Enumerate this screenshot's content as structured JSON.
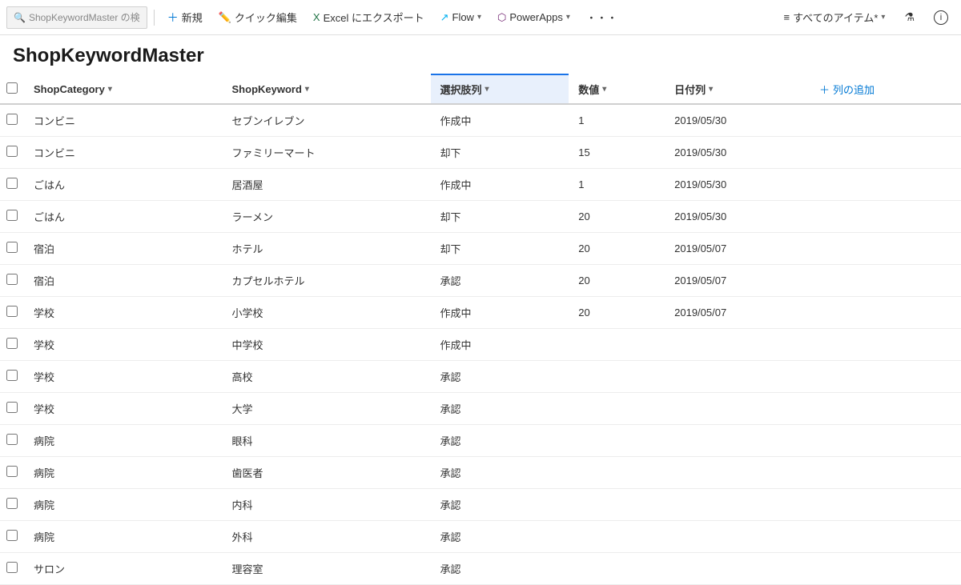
{
  "toolbar": {
    "search_placeholder": "ShopKeywordMaster の検",
    "new_label": "新規",
    "quick_edit_label": "クイック編集",
    "export_excel_label": "Excel にエクスポート",
    "flow_label": "Flow",
    "powerapps_label": "PowerApps",
    "more_label": "・・・",
    "all_items_label": "すべてのアイテム*",
    "filter_label": "",
    "info_label": ""
  },
  "page": {
    "title": "ShopKeywordMaster"
  },
  "table": {
    "columns": [
      {
        "key": "shopCategory",
        "label": "ShopCategory",
        "has_chevron": true,
        "selected": false
      },
      {
        "key": "shopKeyword",
        "label": "ShopKeyword",
        "has_chevron": true,
        "selected": false
      },
      {
        "key": "selectCol",
        "label": "選択肢列",
        "has_chevron": true,
        "selected": true
      },
      {
        "key": "value",
        "label": "数値",
        "has_chevron": true,
        "selected": false
      },
      {
        "key": "dateCol",
        "label": "日付列",
        "has_chevron": true,
        "selected": false
      },
      {
        "key": "addCol",
        "label": "+ 列の追加",
        "has_chevron": false,
        "selected": false
      }
    ],
    "rows": [
      {
        "shopCategory": "コンビニ",
        "shopKeyword": "セブンイレブン",
        "selectCol": "作成中",
        "value": "1",
        "dateCol": "2019/05/30"
      },
      {
        "shopCategory": "コンビニ",
        "shopKeyword": "ファミリーマート",
        "selectCol": "却下",
        "value": "15",
        "dateCol": "2019/05/30"
      },
      {
        "shopCategory": "ごはん",
        "shopKeyword": "居酒屋",
        "selectCol": "作成中",
        "value": "1",
        "dateCol": "2019/05/30"
      },
      {
        "shopCategory": "ごはん",
        "shopKeyword": "ラーメン",
        "selectCol": "却下",
        "value": "20",
        "dateCol": "2019/05/30"
      },
      {
        "shopCategory": "宿泊",
        "shopKeyword": "ホテル",
        "selectCol": "却下",
        "value": "20",
        "dateCol": "2019/05/07"
      },
      {
        "shopCategory": "宿泊",
        "shopKeyword": "カプセルホテル",
        "selectCol": "承認",
        "value": "20",
        "dateCol": "2019/05/07"
      },
      {
        "shopCategory": "学校",
        "shopKeyword": "小学校",
        "selectCol": "作成中",
        "value": "20",
        "dateCol": "2019/05/07"
      },
      {
        "shopCategory": "学校",
        "shopKeyword": "中学校",
        "selectCol": "作成中",
        "value": "",
        "dateCol": ""
      },
      {
        "shopCategory": "学校",
        "shopKeyword": "高校",
        "selectCol": "承認",
        "value": "",
        "dateCol": ""
      },
      {
        "shopCategory": "学校",
        "shopKeyword": "大学",
        "selectCol": "承認",
        "value": "",
        "dateCol": ""
      },
      {
        "shopCategory": "病院",
        "shopKeyword": "眼科",
        "selectCol": "承認",
        "value": "",
        "dateCol": ""
      },
      {
        "shopCategory": "病院",
        "shopKeyword": "歯医者",
        "selectCol": "承認",
        "value": "",
        "dateCol": ""
      },
      {
        "shopCategory": "病院",
        "shopKeyword": "内科",
        "selectCol": "承認",
        "value": "",
        "dateCol": ""
      },
      {
        "shopCategory": "病院",
        "shopKeyword": "外科",
        "selectCol": "承認",
        "value": "",
        "dateCol": ""
      },
      {
        "shopCategory": "サロン",
        "shopKeyword": "理容室",
        "selectCol": "承認",
        "value": "",
        "dateCol": ""
      }
    ]
  }
}
